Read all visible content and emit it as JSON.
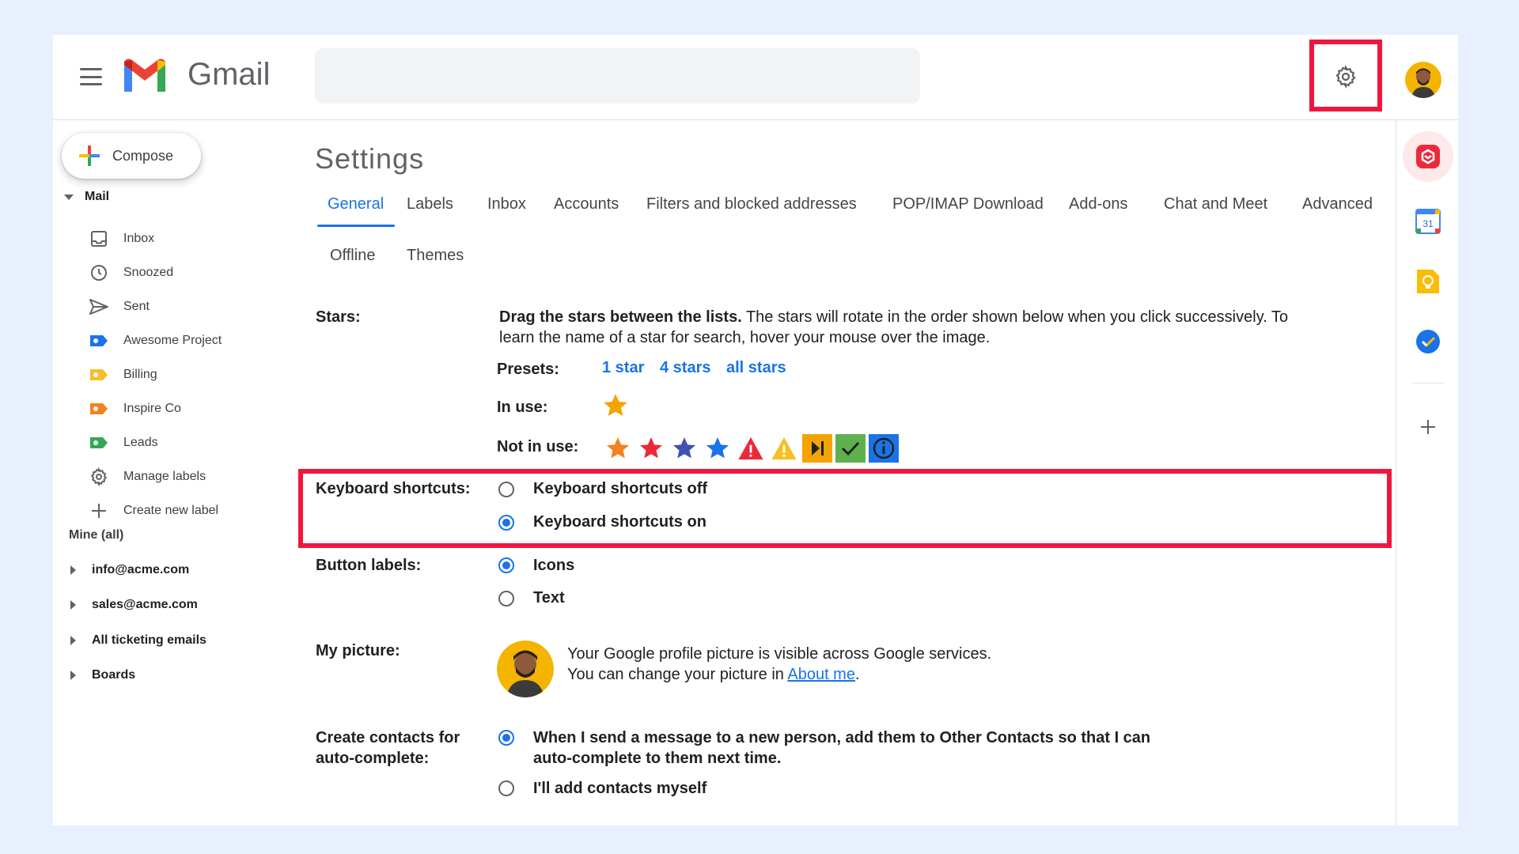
{
  "header": {
    "brand": "Gmail",
    "search_placeholder": ""
  },
  "sidebar": {
    "compose_label": "Compose",
    "mail_section": "Mail",
    "items": [
      {
        "label": "Inbox"
      },
      {
        "label": "Snoozed"
      },
      {
        "label": "Sent"
      },
      {
        "label": "Awesome Project"
      },
      {
        "label": "Billing"
      },
      {
        "label": "Inspire Co"
      },
      {
        "label": "Leads"
      },
      {
        "label": "Manage labels"
      },
      {
        "label": "Create new label"
      }
    ],
    "mine_label": "Mine (all)",
    "accounts": [
      {
        "label": "info@acme.com"
      },
      {
        "label": "sales@acme.com"
      },
      {
        "label": "All ticketing emails"
      },
      {
        "label": "Boards"
      }
    ],
    "label_colors": {
      "awesome_project": "#1a73e8",
      "billing": "#f6bf26",
      "inspire_co": "#f4811f",
      "leads": "#34a853"
    }
  },
  "settings": {
    "title": "Settings",
    "tabs": [
      {
        "label": "General",
        "active": true
      },
      {
        "label": "Labels"
      },
      {
        "label": "Inbox"
      },
      {
        "label": "Accounts"
      },
      {
        "label": "Filters and blocked addresses"
      },
      {
        "label": "POP/IMAP Download"
      },
      {
        "label": "Add-ons"
      },
      {
        "label": "Chat and Meet"
      },
      {
        "label": "Advanced"
      },
      {
        "label": "Offline"
      },
      {
        "label": "Themes"
      }
    ],
    "stars": {
      "label": "Stars:",
      "intro_bold": "Drag the stars between the lists.",
      "intro_line1": " The stars will rotate in the order shown below when you click successively. To",
      "intro_line2": "learn the name of a star for search, hover your mouse over the image.",
      "presets_label": "Presets:",
      "presets": [
        "1 star",
        "4 stars",
        "all stars"
      ],
      "in_use_label": "In use:",
      "not_in_use_label": "Not in use:"
    },
    "keyboard": {
      "label": "Keyboard shortcuts:",
      "off": "Keyboard shortcuts off",
      "on": "Keyboard shortcuts on",
      "selected": "on"
    },
    "button_labels": {
      "label": "Button labels:",
      "icons": "Icons",
      "text": "Text",
      "selected": "icons"
    },
    "my_picture": {
      "label": "My picture:",
      "line1": "Your Google profile picture is visible across Google services.",
      "line2_prefix": "You can change your picture in ",
      "link": "About me",
      "line2_suffix": "."
    },
    "contacts": {
      "label_line1": "Create contacts for",
      "label_line2": "auto-complete:",
      "option1_line1": "When I send a message to a new person, add them to Other Contacts so that I can",
      "option1_line2": "auto-complete to them next time.",
      "option2": "I'll add contacts myself",
      "selected": "option1"
    }
  },
  "right_rail": {
    "calendar_day": "31"
  },
  "colors": {
    "accent": "#1a73e8",
    "highlight": "#f0163e",
    "page_bg": "#e8f0fe"
  }
}
